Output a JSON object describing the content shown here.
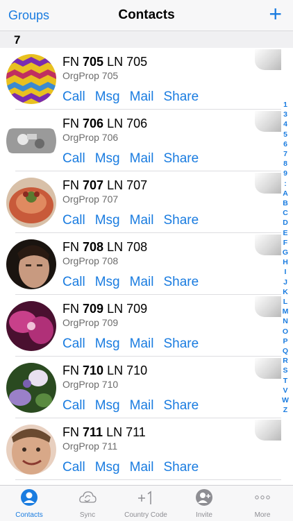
{
  "nav": {
    "left": "Groups",
    "title": "Contacts",
    "add_icon": "plus-icon"
  },
  "section": {
    "title": "7"
  },
  "contacts": [
    {
      "fn": "FN",
      "num": "705",
      "ln": "LN 705",
      "org": "OrgProp 705"
    },
    {
      "fn": "FN",
      "num": "706",
      "ln": "LN 706",
      "org": "OrgProp 706"
    },
    {
      "fn": "FN",
      "num": "707",
      "ln": "LN 707",
      "org": "OrgProp 707"
    },
    {
      "fn": "FN",
      "num": "708",
      "ln": "LN 708",
      "org": "OrgProp 708"
    },
    {
      "fn": "FN",
      "num": "709",
      "ln": "LN 709",
      "org": "OrgProp 709"
    },
    {
      "fn": "FN",
      "num": "710",
      "ln": "LN 710",
      "org": "OrgProp 710"
    },
    {
      "fn": "FN",
      "num": "711",
      "ln": "LN 711",
      "org": "OrgProp 711"
    }
  ],
  "actions": {
    "call": "Call",
    "msg": "Msg",
    "mail": "Mail",
    "share": "Share"
  },
  "index": [
    "1",
    "3",
    "4",
    "5",
    "6",
    "7",
    "8",
    "9",
    ":",
    "A",
    "B",
    "C",
    "D",
    "E",
    "F",
    "G",
    "H",
    "I",
    "J",
    "K",
    "L",
    "M",
    "N",
    "O",
    "P",
    "Q",
    "R",
    "S",
    "T",
    "V",
    "W",
    "Z"
  ],
  "tabs": [
    {
      "label": "Contacts",
      "icon": "person-icon"
    },
    {
      "label": "Sync",
      "icon": "cloud-sync-icon"
    },
    {
      "label": "Country Code",
      "icon": "plus-one-icon"
    },
    {
      "label": "Invite",
      "icon": "invite-person-icon"
    },
    {
      "label": "More",
      "icon": "more-dots-icon"
    }
  ],
  "colors": {
    "accent": "#1a7ce0",
    "tab_inactive": "#8e8e93"
  }
}
